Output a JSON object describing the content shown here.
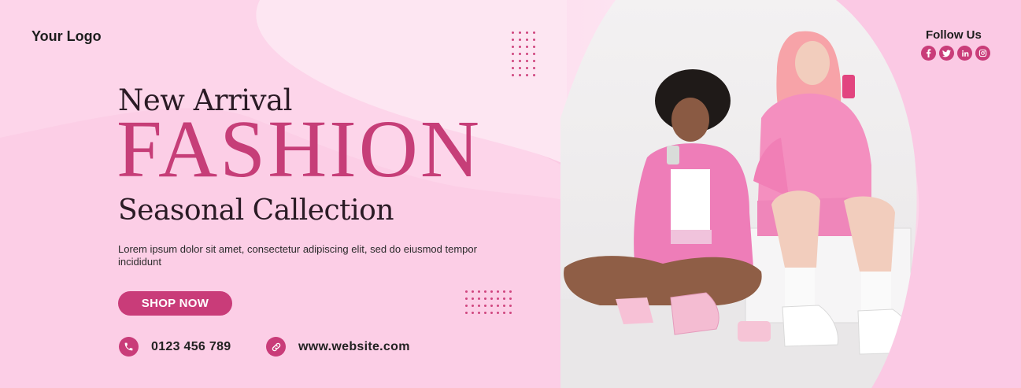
{
  "brand": {
    "logo_text": "Your Logo"
  },
  "headline": {
    "line1": "New Arrival",
    "line2": "FASHION",
    "line3": "Seasonal Callection"
  },
  "description": "Lorem ipsum dolor sit amet, consectetur adipiscing elit, sed do eiusmod tempor incididunt",
  "cta": {
    "label": "SHOP NOW"
  },
  "contact": {
    "phone": "0123 456 789",
    "website": "www.website.com"
  },
  "social": {
    "heading": "Follow Us",
    "icons": [
      "facebook-icon",
      "twitter-icon",
      "linkedin-icon",
      "instagram-icon"
    ]
  },
  "colors": {
    "accent": "#c93c79",
    "background": "#fbd8ec",
    "heading_dark": "#2a1b25"
  }
}
